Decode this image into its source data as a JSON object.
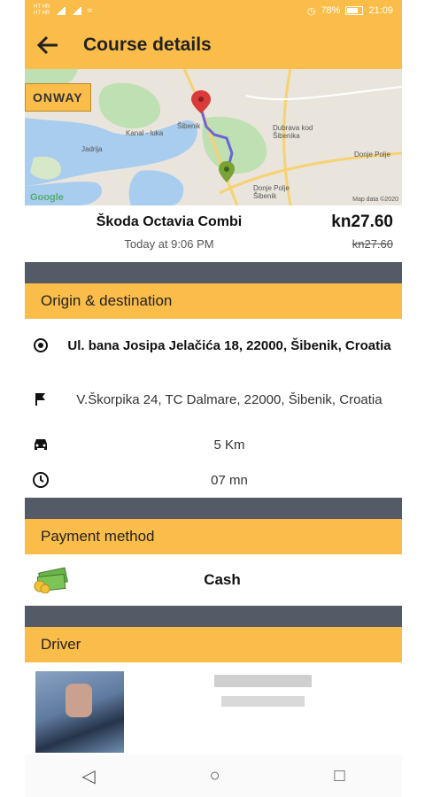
{
  "status_bar": {
    "network_line1": "HT HR",
    "network_line2": "HT HR",
    "battery": "78%",
    "time": "21:09"
  },
  "app_bar": {
    "title": "Course details"
  },
  "map": {
    "badge": "ONWAY",
    "labels": [
      "Kanal - luka",
      "Jadrija",
      "Šibenik",
      "Dubrava kod Šibenika",
      "Donje Polje Šibenik",
      "Donje Polje"
    ],
    "attribution": "Google",
    "map_data": "Map data ©2020"
  },
  "ride": {
    "car": "Škoda Octavia Combi",
    "time": "Today at 9:06 PM",
    "price": "kn27.60",
    "old_price": "kn27.60"
  },
  "origin_destination": {
    "header": "Origin & destination",
    "origin": "Ul. bana Josipa Jelačića 18, 22000, Šibenik, Croatia",
    "destination": "V.Škorpika 24, TC Dalmare, 22000, Šibenik, Croatia",
    "distance": "5 Km",
    "duration": "07 mn"
  },
  "payment": {
    "header": "Payment method",
    "method": "Cash"
  },
  "driver": {
    "header": "Driver"
  },
  "colors": {
    "accent": "#fbbd49",
    "divider": "#545a66",
    "route": "#6a64d8",
    "pin_origin": "#d93a3a",
    "pin_destination": "#7aa336"
  }
}
